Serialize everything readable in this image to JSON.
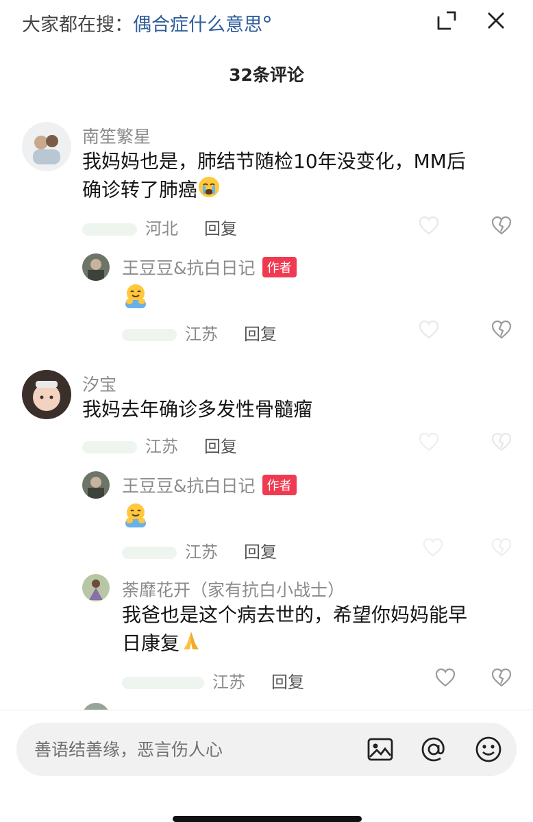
{
  "header": {
    "search_prefix": "大家都在搜：",
    "search_keyword": "偶合症什么意思",
    "comment_count": "32条评论"
  },
  "comments": [
    {
      "user": "南笙繁星",
      "text_line1": "我妈妈也是，肺结节随检10年没变化，MM后",
      "text_line2": "确诊转了肺癌",
      "location": "河北",
      "reply": "回复"
    },
    {
      "user": "王豆豆&抗白日记",
      "tag": "作者",
      "location": "江苏",
      "reply": "回复"
    },
    {
      "user": "汐宝",
      "text": "我妈去年确诊多发性骨髓瘤",
      "location": "江苏",
      "reply": "回复"
    },
    {
      "user": "王豆豆&抗白日记",
      "tag": "作者",
      "location": "江苏",
      "reply": "回复"
    },
    {
      "user": "荼靡花开（家有抗白小战士）",
      "text_line1": "我爸也是这个病去世的，希望你妈妈能早",
      "text_line2": "日康复",
      "location": "江苏",
      "reply": "回复"
    }
  ],
  "input": {
    "placeholder": "善语结善缘，恶言伤人心"
  },
  "icons": [
    "expand-icon",
    "close-icon",
    "like-icon",
    "dislike-icon",
    "image-icon",
    "mention-icon",
    "emoji-icon"
  ]
}
